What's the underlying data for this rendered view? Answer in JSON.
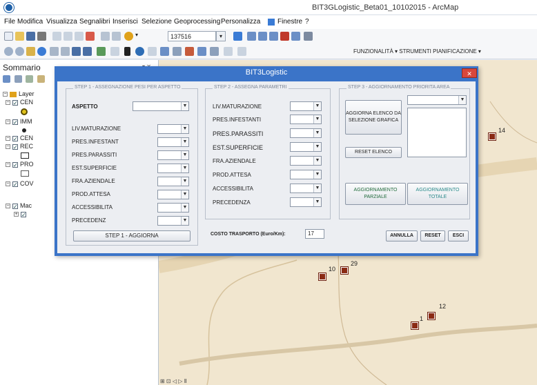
{
  "window": {
    "title": "BIT3GLogistic_Beta01_10102015 - ArcMap"
  },
  "menu": [
    "File",
    "Modifica",
    "Visualizza",
    "Segnalibri",
    "Inserisci",
    "Selezione",
    "Geoprocessing",
    "Personalizza",
    "Finestre",
    "?"
  ],
  "toolbar": {
    "scale": "137516",
    "right_menus": "FUNZIONALITÀ ▾   STRUMENTI PIANIFICAZIONE ▾"
  },
  "toc": {
    "title": "Sommario",
    "items": [
      {
        "label": "Layer"
      },
      {
        "label": "CEN"
      },
      {
        "label": "IMM"
      },
      {
        "label": "CEN"
      },
      {
        "label": "REC"
      },
      {
        "label": "PRO"
      },
      {
        "label": "COV"
      },
      {
        "label": "Mac"
      }
    ]
  },
  "map": {
    "labels": [
      "14",
      "10",
      "29",
      "12",
      "1"
    ],
    "nav": "⊞ ⊡ ◁ ▷ Ⅱ"
  },
  "dialog": {
    "title": "BIT3Logistic",
    "close_label": "✕",
    "step1": {
      "title": "STEP 1 - ASSEGNAZIONE PESI PER ASPETTO",
      "aspetto_label": "ASPETTO",
      "rows": [
        "LIV.MATURAZIONE",
        "PRES.INFESTANT",
        "PRES.PARASSITI",
        "EST.SUPERFICIE",
        "FRA.AZIENDALE",
        "PROD.ATTESA",
        "ACCESSIBILITA",
        "PRECEDENZ"
      ],
      "button": "STEP 1 - AGGIORNA"
    },
    "step2": {
      "title": "STEP 2 - ASSEGNA PARAMETRI",
      "rows": [
        "LIV.MATURAZIONE",
        "PRES.INFESTANTI",
        "PRES.PARASSITI",
        "EST.SUPERFICIE",
        "FRA.AZIENDALE",
        "PROD.ATTESA",
        "ACCESSIBILITA",
        "PRECEDENZA"
      ],
      "cost_label": "COSTO TRASPORTO (Euro/Km):",
      "cost_value": "17"
    },
    "step3": {
      "title": "STEP 3 - AGGIORNAMENTO PRIORITA AREA",
      "update_button": "AGGIORNA ELENCO DA SELEZIONE GRAFICA",
      "reset_list_button": "RESET ELENCO",
      "partial_button": "AGGIORNAMENTO PARZIALE",
      "total_button": "AGGIORNAMENTO TOTALE"
    },
    "footer": {
      "cancel": "ANNULLA",
      "reset": "RESET",
      "exit": "ESCI"
    }
  }
}
